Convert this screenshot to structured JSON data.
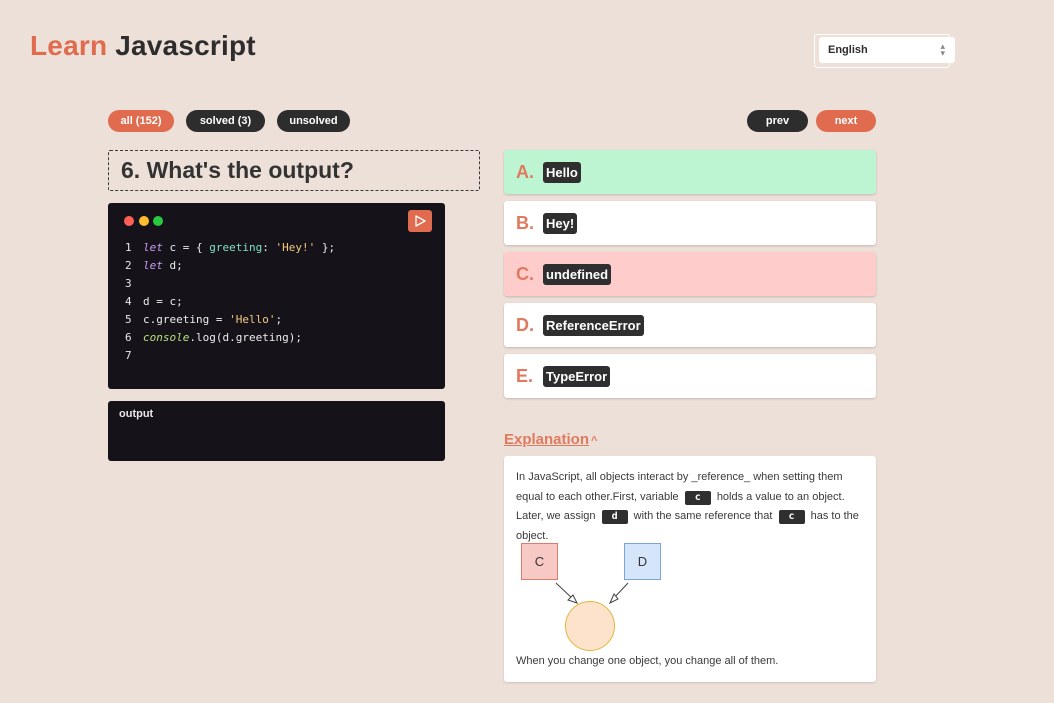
{
  "logo": {
    "accent": "Learn",
    "main": "Javascript"
  },
  "language": {
    "selected": "English"
  },
  "filters": {
    "all": "all (152)",
    "solved": "solved (3)",
    "unsolved": "unsolved"
  },
  "nav": {
    "prev": "prev",
    "next": "next"
  },
  "question": {
    "title": "6. What's the output?"
  },
  "code": {
    "line_numbers": [
      "1",
      "2",
      "3",
      "4",
      "5",
      "6",
      "7"
    ],
    "tokens": {
      "l1_kw": "let",
      "l1_a": " c = { ",
      "l1_prop": "greeting",
      "l1_b": ": ",
      "l1_str": "'Hey!'",
      "l1_c": " };",
      "l2_kw": "let",
      "l2_a": " d;",
      "l4": "d = c;",
      "l5_a": "c.greeting = ",
      "l5_str": "'Hello'",
      "l5_b": ";",
      "l6_obj": "console",
      "l6_a": ".log(d.greeting);"
    }
  },
  "output": {
    "label": "output"
  },
  "options": [
    {
      "letter": "A.",
      "answer": "Hello",
      "state": "correct"
    },
    {
      "letter": "B.",
      "answer": "Hey!",
      "state": "none"
    },
    {
      "letter": "C.",
      "answer": "undefined",
      "state": "wrong"
    },
    {
      "letter": "D.",
      "answer": "ReferenceError",
      "state": "none"
    },
    {
      "letter": "E.",
      "answer": "TypeError",
      "state": "none"
    }
  ],
  "explanation": {
    "toggle": "Explanation",
    "chevron": "^",
    "text_1": "In JavaScript, all objects interact by _reference_ when setting them equal to each other.First, variable",
    "chip_c": "c",
    "text_2": "holds a value to an object. Later, we assign",
    "chip_d": "d",
    "text_3": "with the same reference that",
    "text_4": "has to the object.",
    "diagram_c": "C",
    "diagram_d": "D",
    "footer": "When you change one object, you change all of them."
  },
  "colors": {
    "background": "#ede0d8",
    "accent": "#e06b4f",
    "correct": "#bdf5d3",
    "wrong": "#ffcccc",
    "code_bg": "#15121a"
  }
}
